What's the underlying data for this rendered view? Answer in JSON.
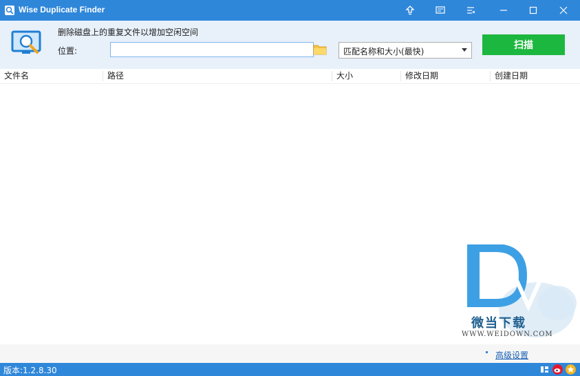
{
  "window": {
    "title": "Wise Duplicate Finder",
    "titlebar_color": "#2f87da"
  },
  "toolbar": {
    "description": "删除磁盘上的重复文件以增加空闲空间",
    "location_label": "位置:",
    "location_value": "",
    "match_mode": "匹配名称和大小(最快)",
    "scan_label": "扫描",
    "scan_color": "#1cb73e"
  },
  "table": {
    "columns": [
      "文件名",
      "路径",
      "大小",
      "修改日期",
      "创建日期"
    ]
  },
  "watermark": {
    "name": "微当下载",
    "url": "WWW.WEIDOWN.COM"
  },
  "footer": {
    "advanced_link": "高级设置"
  },
  "status": {
    "version": "版本:1.2.8.30"
  },
  "icons": [
    "app-icon",
    "upgrade-icon",
    "feedback-icon",
    "menu-icon",
    "minimize-icon",
    "maximize-icon",
    "close-icon",
    "monitor-search-icon",
    "folder-icon",
    "dropdown-arrow-icon",
    "social-icon",
    "weibo-icon",
    "star-icon"
  ]
}
